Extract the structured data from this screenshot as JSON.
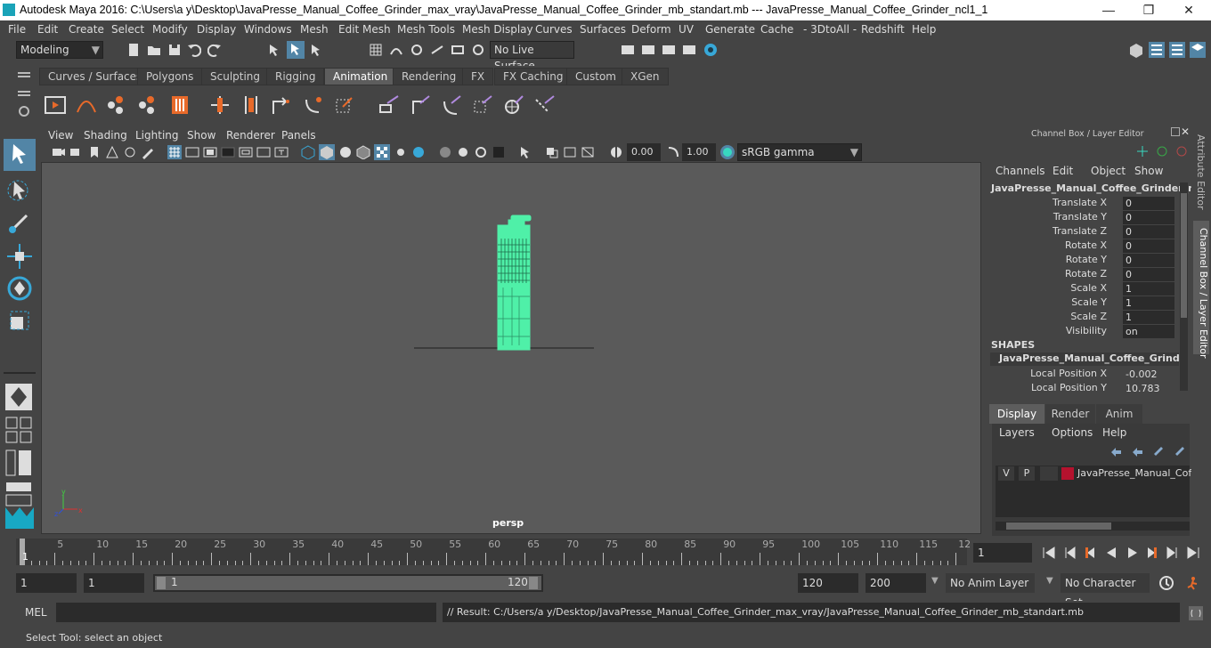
{
  "window": {
    "title": "Autodesk Maya 2016: C:\\Users\\a y\\Desktop\\JavaPresse_Manual_Coffee_Grinder_max_vray\\JavaPresse_Manual_Coffee_Grinder_mb_standart.mb   ---   JavaPresse_Manual_Coffee_Grinder_ncl1_1",
    "controls": {
      "minimize": "—",
      "maximize": "❐",
      "close": "✕"
    }
  },
  "menubar": [
    "File",
    "Edit",
    "Create",
    "Select",
    "Modify",
    "Display",
    "Windows",
    "Mesh",
    "Edit Mesh",
    "Mesh Tools",
    "Mesh Display",
    "Curves",
    "Surfaces",
    "Deform",
    "UV",
    "Generate",
    "Cache",
    "- 3DtoAll -",
    "Redshift",
    "Help"
  ],
  "statusline": {
    "mode": "Modeling",
    "live_surface": "No Live Surface"
  },
  "shelf_tabs": [
    "Curves / Surfaces",
    "Polygons",
    "Sculpting",
    "Rigging",
    "Animation",
    "Rendering",
    "FX",
    "FX Caching",
    "Custom",
    "XGen"
  ],
  "shelf_active": "Animation",
  "viewport": {
    "menu": [
      "View",
      "Shading",
      "Lighting",
      "Show",
      "Renderer",
      "Panels"
    ],
    "exposure": "0.00",
    "gamma": "1.00",
    "color_space": "sRGB gamma",
    "camera_label": "persp",
    "accent": "#4ff0a8"
  },
  "channel_box": {
    "title": "Channel Box / Layer Editor",
    "menu": [
      "Channels",
      "Edit",
      "Object",
      "Show"
    ],
    "object_name": "JavaPresse_Manual_Coffee_Grinder_n...",
    "channels": [
      {
        "label": "Translate X",
        "value": "0"
      },
      {
        "label": "Translate Y",
        "value": "0"
      },
      {
        "label": "Translate Z",
        "value": "0"
      },
      {
        "label": "Rotate X",
        "value": "0"
      },
      {
        "label": "Rotate Y",
        "value": "0"
      },
      {
        "label": "Rotate Z",
        "value": "0"
      },
      {
        "label": "Scale X",
        "value": "1"
      },
      {
        "label": "Scale Y",
        "value": "1"
      },
      {
        "label": "Scale Z",
        "value": "1"
      },
      {
        "label": "Visibility",
        "value": "on"
      }
    ],
    "shapes_header": "SHAPES",
    "shape_name": "JavaPresse_Manual_Coffee_Grinder_...",
    "shape_channels": [
      {
        "label": "Local Position X",
        "value": "-0.002"
      },
      {
        "label": "Local Position Y",
        "value": "10.783"
      }
    ]
  },
  "layer_editor": {
    "tabs": [
      "Display",
      "Render",
      "Anim"
    ],
    "menu": [
      "Layers",
      "Options",
      "Help"
    ],
    "layer": {
      "v": "V",
      "p": "P",
      "name": "JavaPresse_Manual_Coff",
      "color": "#b5122e"
    }
  },
  "side_tabs": [
    "Attribute Editor",
    "Channel Box / Layer Editor"
  ],
  "timeline": {
    "ticks": [
      "5",
      "10",
      "15",
      "20",
      "25",
      "30",
      "35",
      "40",
      "45",
      "50",
      "55",
      "60",
      "65",
      "70",
      "75",
      "80",
      "85",
      "90",
      "95",
      "100",
      "105",
      "110",
      "115",
      "12"
    ],
    "start_label": "1",
    "current_frame": "1"
  },
  "range": {
    "start": "1",
    "playback_start": "1",
    "slider_start": "1",
    "slider_end": "120",
    "playback_end": "120",
    "end": "200",
    "anim_layer": "No Anim Layer",
    "character_set": "No Character Set"
  },
  "mel": {
    "label": "MEL",
    "result": "// Result: C:/Users/a y/Desktop/JavaPresse_Manual_Coffee_Grinder_max_vray/JavaPresse_Manual_Coffee_Grinder_mb_standart.mb"
  },
  "help_line": "Select Tool: select an object"
}
